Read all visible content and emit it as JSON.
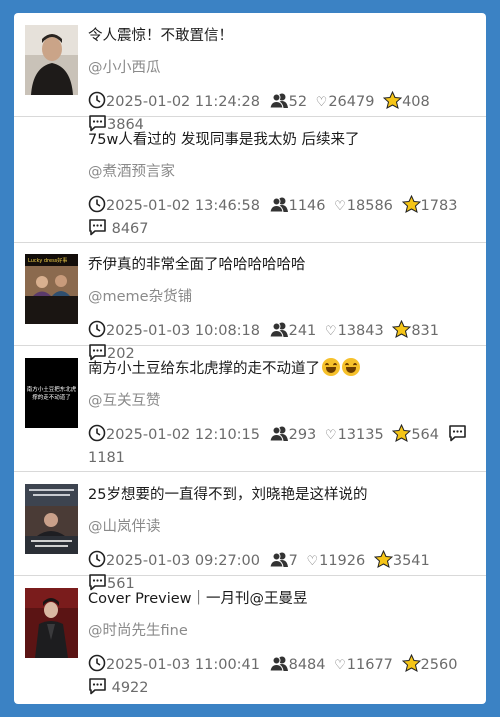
{
  "items": [
    {
      "title": "令人震惊！不敢置信！",
      "author": "@小小西瓜",
      "date": "2025-01-02 11:24:28",
      "fans": "52",
      "likes": "26479",
      "stars": "408",
      "comments": "3864",
      "has_thumb": true
    },
    {
      "title": "75w人看过的 发现同事是我太奶 后续来了",
      "author": "@煮酒预言家",
      "date": "2025-01-02 13:46:58",
      "fans": "1146",
      "likes": "18586",
      "stars": "1783",
      "comments": "8467",
      "has_thumb": false
    },
    {
      "title": "乔伊真的非常全面了哈哈哈哈哈哈",
      "author": "@meme杂货铺",
      "date": "2025-01-03 10:08:18",
      "fans": "241",
      "likes": "13843",
      "stars": "831",
      "comments": "202",
      "has_thumb": true,
      "thumb_text": "Lucky dress好事"
    },
    {
      "title": "南方小土豆给东北虎撑的走不动道了",
      "author": "@互关互赞",
      "date": "2025-01-02 12:10:15",
      "fans": "293",
      "likes": "13135",
      "stars": "564",
      "comments": "1181",
      "has_thumb": true,
      "thumb_text": "南方小土豆把东北虎撑的走不动道了"
    },
    {
      "title": "25岁想要的一直得不到，刘晓艳是这样说的",
      "author": "@山岚伴读",
      "date": "2025-01-03 09:27:00",
      "fans": "7",
      "likes": "11926",
      "stars": "3541",
      "comments": "561",
      "has_thumb": true
    },
    {
      "title": "Cover Preview｜一月刊@王曼昱",
      "author": "@时尚先生fine",
      "date": "2025-01-03 11:00:41",
      "fans": "8484",
      "likes": "11677",
      "stars": "2560",
      "comments": "4922",
      "has_thumb": true
    }
  ],
  "colors": {
    "background": "#3b82c4",
    "star": "#f5c518",
    "text_secondary": "#8a8a8a"
  },
  "icons": [
    "clock-icon",
    "fans-icon",
    "heart-icon",
    "star-icon",
    "comment-icon",
    "laughing-emoji-icon"
  ]
}
